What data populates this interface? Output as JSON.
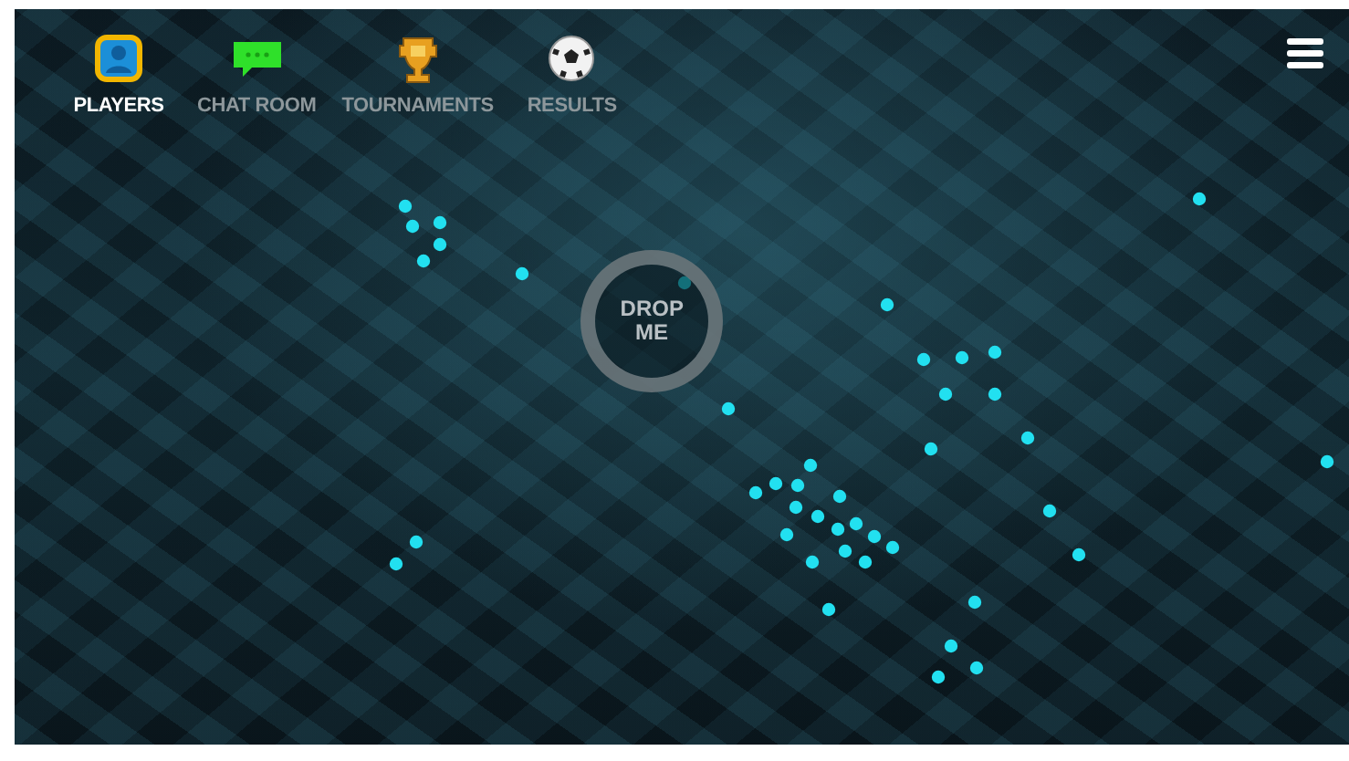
{
  "nav": {
    "tabs": [
      {
        "label": "PLAYERS",
        "kind": "players",
        "selected": true
      },
      {
        "label": "CHAT ROOM",
        "kind": "chat",
        "selected": false
      },
      {
        "label": "TOURNAMENTS",
        "kind": "trophy",
        "selected": false
      },
      {
        "label": "RESULTS",
        "kind": "ball",
        "selected": false
      }
    ]
  },
  "drop_target": {
    "label": "DROP ME"
  }
}
